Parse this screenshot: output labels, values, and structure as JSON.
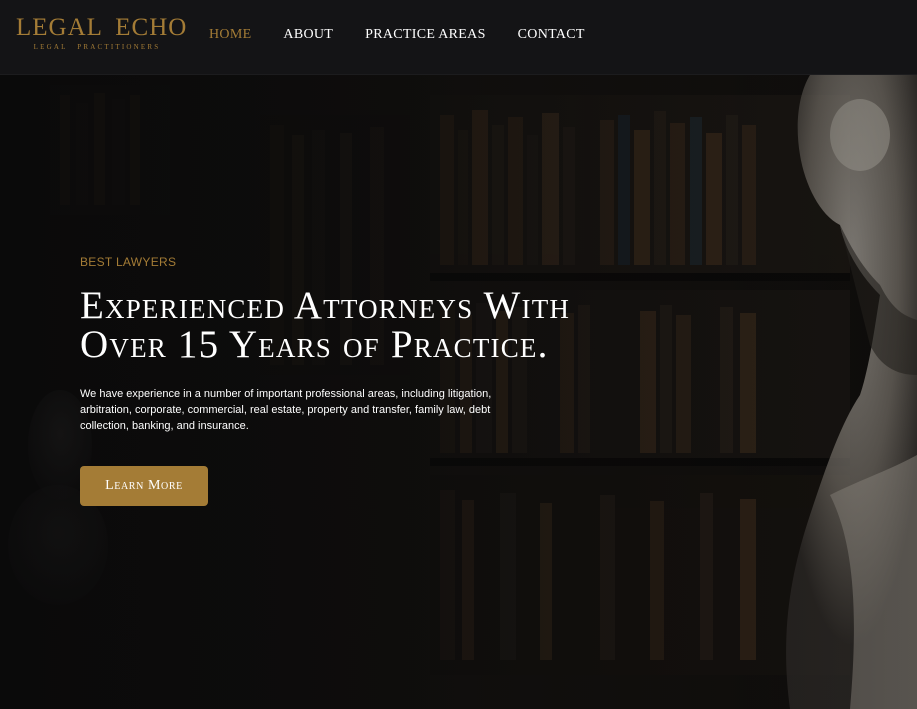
{
  "brand": {
    "name": "LEGAL ECHO",
    "tagline": "LEGAL PRACTITIONERS",
    "accent_color": "#a47c36"
  },
  "nav": {
    "items": [
      {
        "label": "HOME",
        "active": true
      },
      {
        "label": "ABOUT",
        "active": false
      },
      {
        "label": "PRACTICE AREAS",
        "active": false
      },
      {
        "label": "CONTACT",
        "active": false
      }
    ]
  },
  "hero": {
    "background": "library-bookshelves-with-marble-bust",
    "eyebrow": "BEST LAWYERS",
    "headline_line1": "Experienced Attorneys With",
    "headline_line2": "Over 15 Years of Practice.",
    "description": "We have experience in a number of important professional areas, including litigation, arbitration, corporate, commercial, real estate, property and transfer, family law, debt collection, banking, and insurance.",
    "cta_label": "Learn More"
  }
}
